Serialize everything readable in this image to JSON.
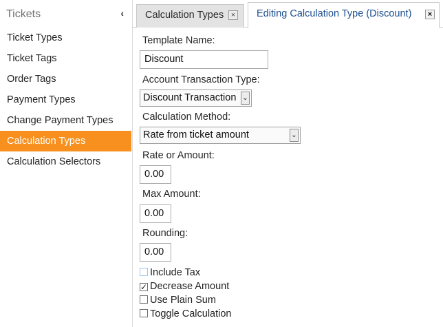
{
  "sidebar": {
    "title": "Tickets",
    "collapse_glyph": "‹",
    "items": [
      {
        "label": "Ticket Types"
      },
      {
        "label": "Ticket Tags"
      },
      {
        "label": "Order Tags"
      },
      {
        "label": "Payment Types"
      },
      {
        "label": "Change Payment Types"
      },
      {
        "label": "Calculation Types"
      },
      {
        "label": "Calculation Selectors"
      }
    ],
    "active_index": 5,
    "active_color": "#f7901e"
  },
  "tabs": [
    {
      "label": "Calculation Types",
      "close_glyph": "×",
      "active": false
    },
    {
      "label": "Editing Calculation Type (Discount)",
      "close_glyph": "×",
      "active": true
    }
  ],
  "form": {
    "template_name": {
      "label": "Template Name:",
      "value": "Discount"
    },
    "account_transaction_type": {
      "label": "Account Transaction Type:",
      "value": "Discount Transaction"
    },
    "calculation_method": {
      "label": "Calculation Method:",
      "value": "Rate from ticket amount"
    },
    "rate_or_amount": {
      "label": "Rate or Amount:",
      "value": "0.00"
    },
    "max_amount": {
      "label": "Max Amount:",
      "value": "0.00"
    },
    "rounding": {
      "label": "Rounding:",
      "value": "0.00"
    },
    "dropdown_glyph": "⌄",
    "checkboxes": [
      {
        "label": "Include Tax",
        "checked": false
      },
      {
        "label": "Decrease Amount",
        "checked": true
      },
      {
        "label": "Use Plain Sum",
        "checked": false
      },
      {
        "label": "Toggle Calculation",
        "checked": false
      }
    ]
  }
}
